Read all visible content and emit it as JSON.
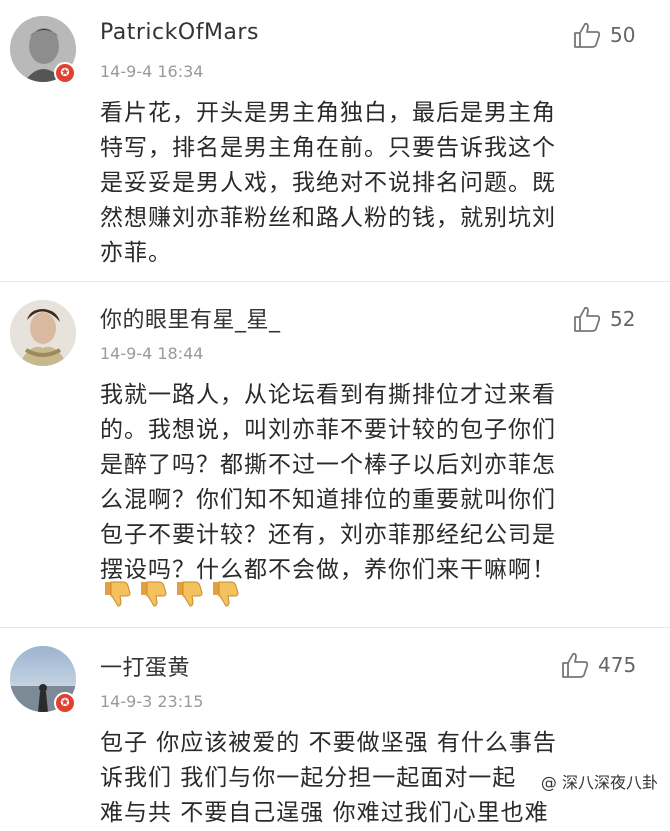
{
  "comments": [
    {
      "username": "PatrickOfMars",
      "timestamp": "14-9-4 16:34",
      "likes": "50",
      "badge": "✪",
      "lines": [
        "看片花，开头是男主角独白，最后是男主角",
        "特写，排名是男主角在前。只要告诉我这个",
        "是妥妥是男人戏，我绝对不说排名问题。既",
        "然想赚刘亦菲粉丝和路人粉的钱，就别坑刘",
        "亦菲。"
      ]
    },
    {
      "username": "你的眼里有星_星_",
      "timestamp": "14-9-4 18:44",
      "likes": "52",
      "lines": [
        "我就一路人，从论坛看到有撕排位才过来看",
        "的。我想说，叫刘亦菲不要计较的包子你们",
        "是醉了吗？都撕不过一个棒子以后刘亦菲怎",
        "么混啊？你们知不知道排位的重要就叫你们",
        "包子不要计较？还有，刘亦菲那经纪公司是",
        "摆设吗？什么都不会做，养你们来干嘛啊！"
      ],
      "emojis": [
        "thumbs-down",
        "thumbs-down",
        "thumbs-down",
        "thumbs-down"
      ]
    },
    {
      "username": "一打蛋黄",
      "timestamp": "14-9-3 23:15",
      "likes": "475",
      "badge": "✪",
      "lines": [
        "包子 你应该被爱的 不要做坚强 有什么事告",
        "诉我们 我们与你一起分担一起面对一起",
        "难与共 不要自己逞强 你难过我们心里也难"
      ]
    }
  ],
  "watermark": "@ 深八深夜八卦",
  "colors": {
    "badge": "#e0402f",
    "text": "#2a2a2a",
    "meta": "#9a9a9a"
  }
}
